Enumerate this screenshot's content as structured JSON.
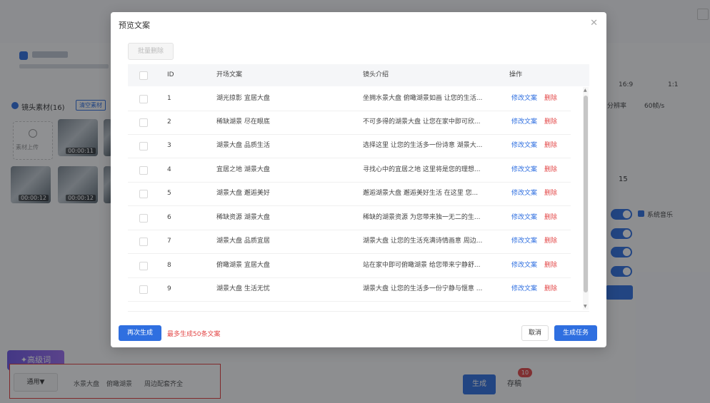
{
  "modal": {
    "title": "预览文案",
    "close_icon": "close-icon",
    "batch_delete_label": "批量删除",
    "columns": {
      "id": "ID",
      "opening": "开场文案",
      "intro": "镜头介绍",
      "actions": "操作"
    },
    "rows": [
      {
        "id": "1",
        "opening": "湖光掠影 宜居大盘",
        "intro": "坐拥水景大盘 俯瞰湖景如画 让您的生活...",
        "edit": "修改文案",
        "delete": "删除"
      },
      {
        "id": "2",
        "opening": "稀缺湖景 尽在眼底",
        "intro": "不可多得的湖景大盘 让您在家中即可欣...",
        "edit": "修改文案",
        "delete": "删除"
      },
      {
        "id": "3",
        "opening": "湖景大盘 品质生活",
        "intro": "选择这里 让您的生活多一份诗意 湖景大...",
        "edit": "修改文案",
        "delete": "删除"
      },
      {
        "id": "4",
        "opening": "宜居之地 湖景大盘",
        "intro": "寻找心中的宜居之地 这里将是您的理想...",
        "edit": "修改文案",
        "delete": "删除"
      },
      {
        "id": "5",
        "opening": "湖景大盘 邂逅美好",
        "intro": "邂逅湖景大盘 邂逅美好生活 在这里 您...",
        "edit": "修改文案",
        "delete": "删除"
      },
      {
        "id": "6",
        "opening": "稀缺资源 湖景大盘",
        "intro": "稀缺的湖景资源 为您带来独一无二的生...",
        "edit": "修改文案",
        "delete": "删除"
      },
      {
        "id": "7",
        "opening": "湖景大盘 品质宜居",
        "intro": "湖景大盘 让您的生活充满诗情画意 周边...",
        "edit": "修改文案",
        "delete": "删除"
      },
      {
        "id": "8",
        "opening": "俯瞰湖景 宜居大盘",
        "intro": "站在家中即可俯瞰湖景 给您带来宁静舒...",
        "edit": "修改文案",
        "delete": "删除"
      },
      {
        "id": "9",
        "opening": "湖景大盘 生活无忧",
        "intro": "湖景大盘 让您的生活多一份宁静与惬意 ...",
        "edit": "修改文案",
        "delete": "删除"
      }
    ],
    "regenerate_label": "再次生成",
    "limit_note": "最多生成50条文案",
    "cancel_label": "取消",
    "create_task_label": "生成任务"
  },
  "background": {
    "section_title": "镜头素材(16)",
    "clear_label": "清空素材",
    "upload_label": "素材上传",
    "thumb_durations": [
      "00:00:11",
      "00:00:12",
      "00:00:12"
    ],
    "value_15": "15",
    "bgm_label": "系统音乐",
    "res_label": "分辨率",
    "fps_label": "60帧/s",
    "ratio_1": "16:9",
    "ratio_2": "1:1",
    "ai_button": "高级词",
    "scope_label": "通用▼",
    "keywords": [
      "水景大盘",
      "俯瞰湖景",
      "周边配套齐全"
    ],
    "generate_label": "生成",
    "save_label": "存稿",
    "save_badge": "10"
  },
  "colors": {
    "primary": "#2f6fe0",
    "danger": "#e34848",
    "highlight_box": "#e03a3a"
  }
}
